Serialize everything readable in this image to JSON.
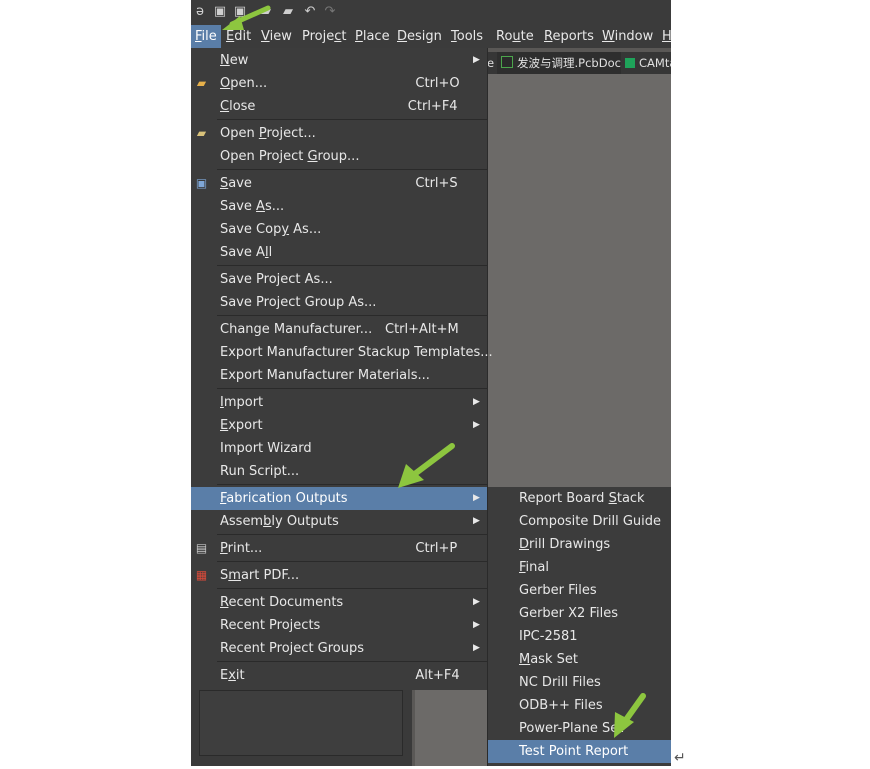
{
  "menubar": {
    "items": [
      {
        "label": "File",
        "ul": "F",
        "rest": "ile"
      },
      {
        "label": "Edit",
        "ul": "E",
        "rest": "dit"
      },
      {
        "label": "View",
        "ul": "V",
        "rest": "iew"
      },
      {
        "label": "Project",
        "pre": "Proje",
        "ul": "c",
        "rest": "t"
      },
      {
        "label": "Place",
        "ul": "P",
        "rest": "lace"
      },
      {
        "label": "Design",
        "ul": "D",
        "rest": "esign"
      },
      {
        "label": "Tools",
        "ul": "T",
        "rest": "ools"
      },
      {
        "label": "Route",
        "pre": "Ro",
        "ul": "u",
        "rest": "te"
      },
      {
        "label": "Reports",
        "ul": "R",
        "rest": "eports"
      },
      {
        "label": "Window",
        "ul": "W",
        "rest": "indow"
      },
      {
        "label": "H",
        "ul": "H",
        "rest": ""
      }
    ]
  },
  "tabs": [
    {
      "label": "e"
    },
    {
      "label": "发波与调理.PcbDoc *"
    },
    {
      "label": "CAMta"
    }
  ],
  "file_menu": [
    {
      "label": "New",
      "ul": "N",
      "rest": "ew",
      "submenu": true
    },
    {
      "label": "Open...",
      "ul": "O",
      "rest": "pen...",
      "shortcut": "Ctrl+O",
      "icon": "open-folder-icon"
    },
    {
      "label": "Close",
      "ul": "C",
      "rest": "lose",
      "shortcut": "Ctrl+F4"
    },
    {
      "label": "Open Project...",
      "pre": "Open ",
      "ul": "P",
      "rest": "roject...",
      "icon": "open-project-icon"
    },
    {
      "label": "Open Project Group...",
      "pre": "Open Project ",
      "ul": "G",
      "rest": "roup..."
    },
    {
      "label": "Save",
      "ul": "S",
      "rest": "ave",
      "shortcut": "Ctrl+S",
      "icon": "save-icon"
    },
    {
      "label": "Save As...",
      "pre": "Save ",
      "ul": "A",
      "rest": "s..."
    },
    {
      "label": "Save Copy As...",
      "pre": "Save Cop",
      "ul": "y",
      "rest": " As..."
    },
    {
      "label": "Save All",
      "pre": "Save A",
      "ul": "l",
      "rest": "l"
    },
    {
      "label": "Save Project As..."
    },
    {
      "label": "Save Project Group As..."
    },
    {
      "label": "Change Manufacturer...",
      "shortcut": "Ctrl+Alt+M"
    },
    {
      "label": "Export Manufacturer Stackup Templates..."
    },
    {
      "label": "Export Manufacturer Materials..."
    },
    {
      "label": "Import",
      "ul": "I",
      "rest": "mport",
      "submenu": true
    },
    {
      "label": "Export",
      "ul": "E",
      "rest": "xport",
      "submenu": true
    },
    {
      "label": "Import Wizard"
    },
    {
      "label": "Run Script..."
    },
    {
      "label": "Fabrication Outputs",
      "ul": "F",
      "rest": "abrication Outputs",
      "submenu": true,
      "highlighted": true
    },
    {
      "label": "Assembly Outputs",
      "pre": "Assem",
      "ul": "b",
      "rest": "ly Outputs",
      "submenu": true
    },
    {
      "label": "Print...",
      "ul": "P",
      "rest": "rint...",
      "shortcut": "Ctrl+P",
      "icon": "printer-icon"
    },
    {
      "label": "Smart PDF...",
      "pre": "S",
      "ul": "m",
      "rest": "art PDF...",
      "icon": "pdf-icon"
    },
    {
      "label": "Recent Documents",
      "ul": "R",
      "rest": "ecent Documents",
      "submenu": true
    },
    {
      "label": "Recent Projects",
      "submenu": true
    },
    {
      "label": "Recent Project Groups",
      "submenu": true
    },
    {
      "label": "Exit",
      "pre": "E",
      "ul": "x",
      "rest": "it",
      "shortcut": "Alt+F4"
    }
  ],
  "fabrication_submenu": [
    {
      "label": "Report Board Stack",
      "pre": "Report Board ",
      "ul": "S",
      "rest": "tack"
    },
    {
      "label": "Composite Drill Guide"
    },
    {
      "label": "Drill Drawings",
      "ul": "D",
      "rest": "rill Drawings"
    },
    {
      "label": "Final",
      "ul": "F",
      "rest": "inal"
    },
    {
      "label": "Gerber Files"
    },
    {
      "label": "Gerber X2 Files"
    },
    {
      "label": "IPC-2581"
    },
    {
      "label": "Mask Set",
      "ul": "M",
      "rest": "ask Set"
    },
    {
      "label": "NC Drill Files"
    },
    {
      "label": "ODB++ Files"
    },
    {
      "label": "Power-Plane Set"
    },
    {
      "label": "Test Point Report",
      "highlighted": true
    }
  ],
  "colors": {
    "menu_bg": "#3c3c3c",
    "highlight": "#5a7ea8",
    "annotation_arrow": "#8dc63f"
  },
  "return_mark": "↵"
}
